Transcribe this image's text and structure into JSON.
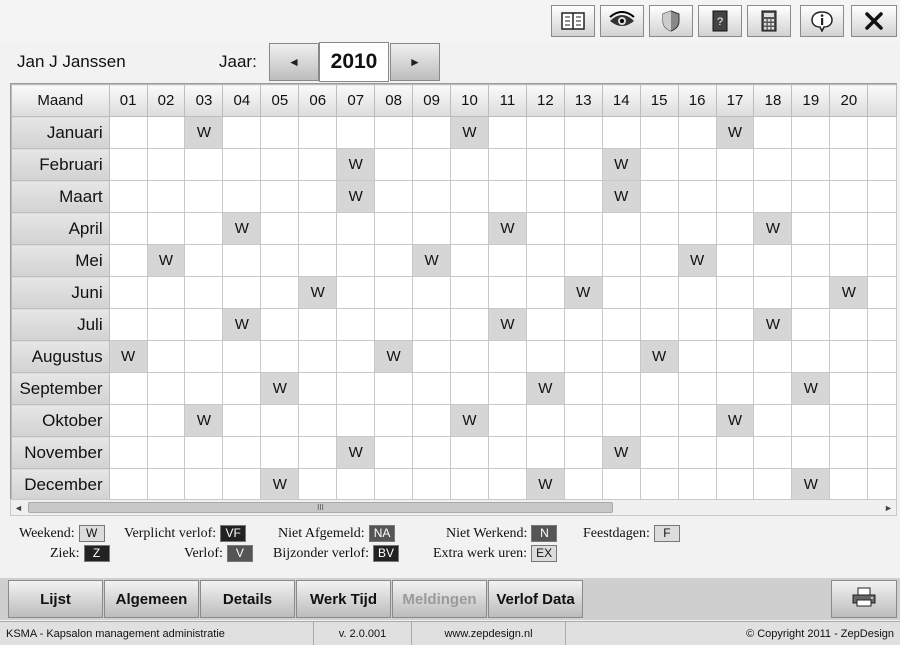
{
  "toolbar": {
    "icons": [
      "agenda-icon",
      "eye-icon",
      "shield-icon",
      "help-book-icon",
      "calculator-icon",
      "info-icon",
      "close-icon"
    ]
  },
  "header": {
    "person": "Jan J Janssen",
    "year_label": "Jaar:",
    "year": "2010",
    "prev_glyph": "◄",
    "next_glyph": "►"
  },
  "grid": {
    "corner": "Maand",
    "days": [
      "01",
      "02",
      "03",
      "04",
      "05",
      "06",
      "07",
      "08",
      "09",
      "10",
      "11",
      "12",
      "13",
      "14",
      "15",
      "16",
      "17",
      "18",
      "19",
      "20"
    ],
    "months": [
      {
        "name": "Januari",
        "cells": {
          "03": "W",
          "10": "W",
          "17": "W"
        }
      },
      {
        "name": "Februari",
        "cells": {
          "07": "W",
          "14": "W"
        }
      },
      {
        "name": "Maart",
        "cells": {
          "07": "W",
          "14": "W"
        }
      },
      {
        "name": "April",
        "cells": {
          "04": "W",
          "11": "W",
          "18": "W"
        }
      },
      {
        "name": "Mei",
        "cells": {
          "02": "W",
          "09": "W",
          "16": "W"
        }
      },
      {
        "name": "Juni",
        "cells": {
          "06": "W",
          "13": "W",
          "20": "W"
        }
      },
      {
        "name": "Juli",
        "cells": {
          "04": "W",
          "11": "W",
          "18": "W"
        }
      },
      {
        "name": "Augustus",
        "cells": {
          "01": "W",
          "08": "W",
          "15": "W"
        }
      },
      {
        "name": "September",
        "cells": {
          "05": "W",
          "12": "W",
          "19": "W"
        }
      },
      {
        "name": "Oktober",
        "cells": {
          "03": "W",
          "10": "W",
          "17": "W"
        }
      },
      {
        "name": "November",
        "cells": {
          "07": "W",
          "14": "W"
        }
      },
      {
        "name": "December",
        "cells": {
          "05": "W",
          "12": "W",
          "19": "W"
        }
      }
    ]
  },
  "scrollbar": {
    "left": "◄",
    "right": "►",
    "grip": "III"
  },
  "legend": {
    "weekend": {
      "label": "Weekend:",
      "code": "W"
    },
    "ziek": {
      "label": "Ziek:",
      "code": "Z"
    },
    "verplicht": {
      "label": "Verplicht verlof:",
      "code": "VF"
    },
    "verlof": {
      "label": "Verlof:",
      "code": "V"
    },
    "niet_afgemeld": {
      "label": "Niet Afgemeld:",
      "code": "NA"
    },
    "bijzonder": {
      "label": "Bijzonder verlof:",
      "code": "BV"
    },
    "niet_werkend": {
      "label": "Niet Werkend:",
      "code": "N"
    },
    "extra": {
      "label": "Extra werk uren:",
      "code": "EX"
    },
    "feestdagen": {
      "label": "Feestdagen:",
      "code": "F"
    }
  },
  "tabs": [
    "Lijst",
    "Algemeen",
    "Details",
    "Werk Tijd",
    "Meldingen",
    "Verlof Data"
  ],
  "status": {
    "app": "KSMA - Kapsalon management administratie",
    "version": "v. 2.0.001",
    "url": "www.zepdesign.nl",
    "copyright": "© Copyright 2011 - ZepDesign"
  }
}
